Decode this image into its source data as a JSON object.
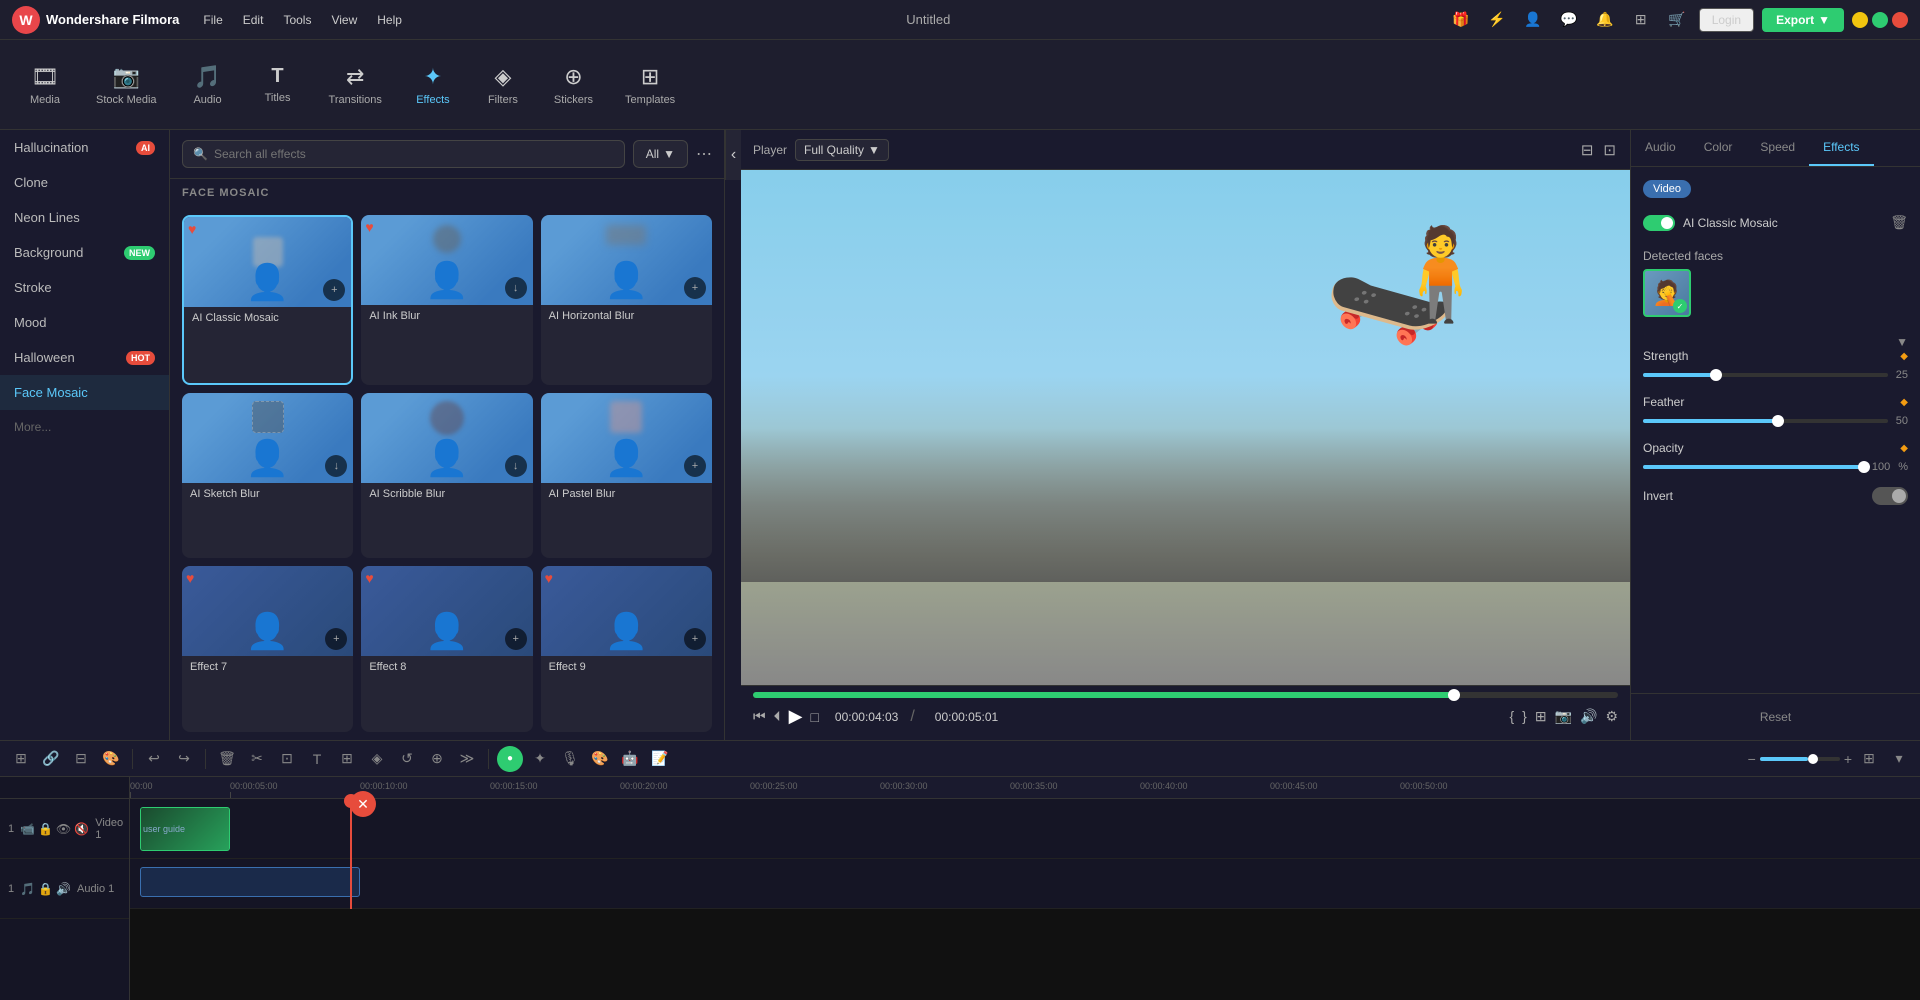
{
  "app": {
    "name": "Wondershare Filmora",
    "logo": "W",
    "window_title": "Untitled"
  },
  "titlebar": {
    "menu_items": [
      "File",
      "Edit",
      "Tools",
      "View",
      "Help"
    ],
    "login_label": "Login",
    "export_label": "Export"
  },
  "toolbar": {
    "items": [
      {
        "id": "media",
        "label": "Media",
        "icon": "🎞"
      },
      {
        "id": "stock_media",
        "label": "Stock Media",
        "icon": "📷"
      },
      {
        "id": "audio",
        "label": "Audio",
        "icon": "🎵"
      },
      {
        "id": "titles",
        "label": "Titles",
        "icon": "T"
      },
      {
        "id": "transitions",
        "label": "Transitions",
        "icon": "⇄"
      },
      {
        "id": "effects",
        "label": "Effects",
        "icon": "✦"
      },
      {
        "id": "filters",
        "label": "Filters",
        "icon": "◈"
      },
      {
        "id": "stickers",
        "label": "Stickers",
        "icon": "⊕"
      },
      {
        "id": "templates",
        "label": "Templates",
        "icon": "⊞"
      }
    ],
    "active": "effects"
  },
  "left_sidebar": {
    "items": [
      {
        "label": "Hallucination",
        "badge": "red",
        "badge_text": "AI"
      },
      {
        "label": "Clone",
        "badge": null
      },
      {
        "label": "Neon Lines",
        "badge": null
      },
      {
        "label": "Background",
        "badge": "new",
        "badge_text": "NEW"
      },
      {
        "label": "Stroke",
        "badge": null
      },
      {
        "label": "Mood",
        "badge": null
      },
      {
        "label": "Halloween",
        "badge": "hot",
        "badge_text": "HOT"
      },
      {
        "label": "Face Mosaic",
        "badge": null,
        "active": true
      },
      {
        "label": "More...",
        "badge": null
      }
    ]
  },
  "effects_panel": {
    "search_placeholder": "Search all effects",
    "filter_label": "All",
    "section_title": "FACE MOSAIC",
    "effects": [
      {
        "label": "AI Classic Mosaic",
        "has_heart": true,
        "action": "+",
        "selected": true
      },
      {
        "label": "AI Ink Blur",
        "has_heart": true,
        "action": "↓"
      },
      {
        "label": "AI Horizontal Blur",
        "has_heart": false,
        "action": "+"
      },
      {
        "label": "AI Sketch Blur",
        "has_heart": false,
        "action": "↓"
      },
      {
        "label": "AI Scribble Blur",
        "has_heart": false,
        "action": "↓"
      },
      {
        "label": "AI Pastel Blur",
        "has_heart": false,
        "action": "+"
      },
      {
        "label": "Effect 7",
        "has_heart": true,
        "action": "+"
      },
      {
        "label": "Effect 8",
        "has_heart": true,
        "action": "+"
      },
      {
        "label": "Effect 9",
        "has_heart": true,
        "action": "+"
      }
    ]
  },
  "preview": {
    "player_label": "Player",
    "quality_label": "Full Quality",
    "current_time": "00:00:04:03",
    "total_time": "00:00:05:01",
    "progress_percent": 81
  },
  "right_panel": {
    "tabs": [
      "Audio",
      "Color",
      "Speed",
      "Effects"
    ],
    "active_tab": "Effects",
    "video_chip": "Video",
    "effect_name": "AI Classic Mosaic",
    "detected_faces_label": "Detected faces",
    "sliders": [
      {
        "name": "Strength",
        "value": 25,
        "percent": 30
      },
      {
        "name": "Feather",
        "value": 50,
        "percent": 55
      },
      {
        "name": "Opacity",
        "value": 100,
        "percent": 100,
        "suffix": "%"
      }
    ],
    "invert_label": "Invert",
    "reset_label": "Reset"
  },
  "timeline": {
    "time_markers": [
      "00:00",
      "00:00:05:00",
      "00:00:10:00",
      "00:00:15:00",
      "00:00:20:00",
      "00:00:25:00",
      "00:00:30:00",
      "00:00:35:00",
      "00:00:40:00",
      "00:00:45:00",
      "00:00:50:00"
    ],
    "tracks": [
      {
        "label": "Video 1"
      },
      {
        "label": "Audio 1"
      }
    ],
    "playhead_pos": "220px"
  }
}
